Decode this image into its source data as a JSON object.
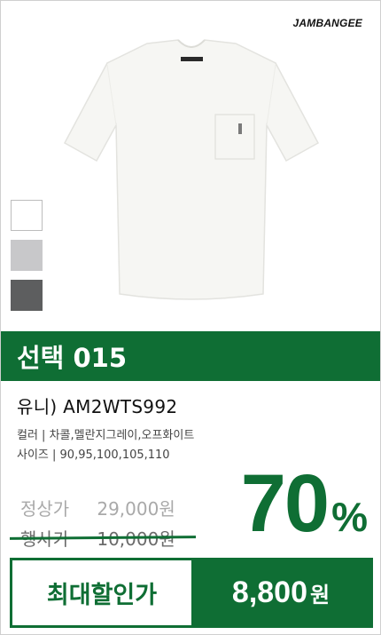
{
  "brand": {
    "name": "JAMBANGEE"
  },
  "product": {
    "swatch_colors": [
      "#ffffff",
      "#c8c8ca",
      "#5d5e5f"
    ],
    "image_icon": "tshirt-icon"
  },
  "banner": {
    "text": "선택 015",
    "color": "#0f6e34"
  },
  "details": {
    "model": "유니) AM2WTS992",
    "colors": "컬러 | 차콜,멜란지그레이,오프화이트",
    "sizes": "사이즈 | 90,95,100,105,110"
  },
  "pricing": {
    "regular_label": "정상가",
    "regular_price": "29,000원",
    "event_label": "행사가",
    "event_price": "10,000원",
    "discount_value": "70",
    "discount_unit": "%",
    "final_label": "최대할인가",
    "final_price": "8,800",
    "final_unit": "원"
  }
}
